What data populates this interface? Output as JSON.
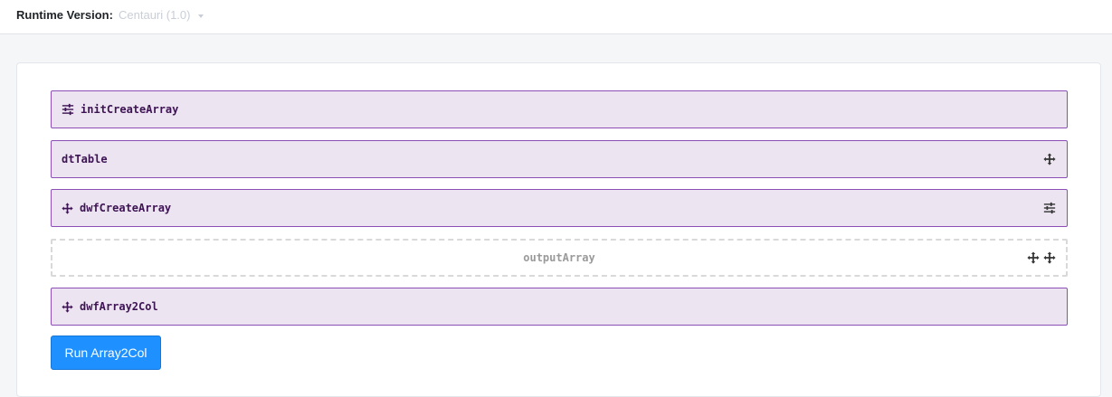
{
  "header": {
    "runtime_label": "Runtime Version:",
    "runtime_value": "Centauri (1.0)"
  },
  "blocks": [
    {
      "label": "initCreateArray",
      "left_icon": "sliders-icon",
      "right_icons": []
    },
    {
      "label": "dtTable",
      "left_icon": null,
      "right_icons": [
        "move-icon"
      ]
    },
    {
      "label": "dwfCreateArray",
      "left_icon": "move-icon",
      "right_icons": [
        "sliders-icon"
      ]
    },
    {
      "label": "outputArray",
      "left_icon": null,
      "right_icons": [
        "move-icon",
        "move-icon"
      ],
      "style": "dashed-placeholder"
    },
    {
      "label": "dwfArray2Col",
      "left_icon": "move-icon",
      "right_icons": []
    }
  ],
  "actions": {
    "run_label": "Run Array2Col"
  },
  "colors": {
    "block_bg": "#ece4f1",
    "block_border": "#8b4fb5",
    "block_text": "#3d1354",
    "button_bg": "#1e90ff"
  }
}
